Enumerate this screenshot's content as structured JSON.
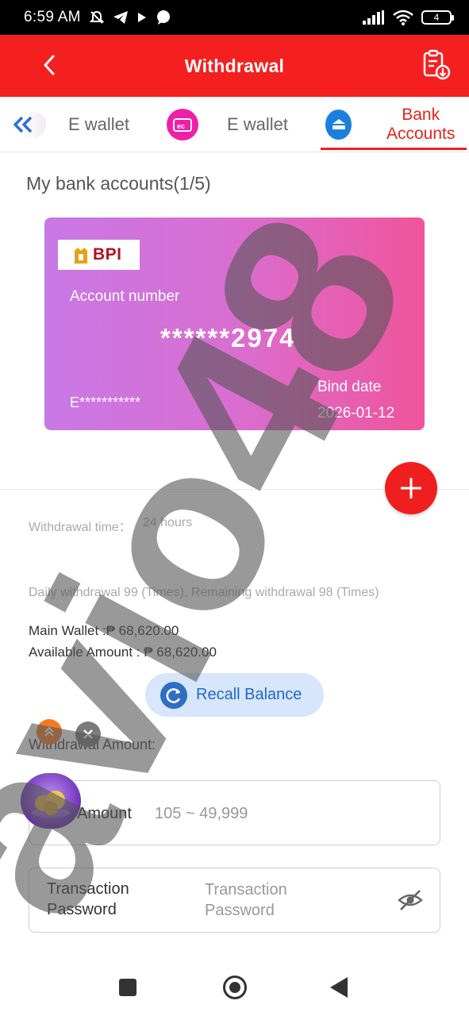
{
  "status_bar": {
    "time": "6:59 AM",
    "battery": "4",
    "icons": [
      "mute-icon",
      "telegram-icon",
      "play-icon",
      "chat-icon",
      "signal-icon",
      "wifi-icon",
      "battery-icon"
    ]
  },
  "header": {
    "title": "Withdrawal",
    "back_icon": "chevron-left-icon",
    "record_icon": "clipboard-download-icon",
    "background": "#f4201f"
  },
  "tabs": [
    {
      "label": "E wallet",
      "icon": ""
    },
    {
      "label": "E wallet",
      "icon": "ewallet-icon",
      "icon_color": "#f01fa8"
    },
    {
      "label": "Bank Accounts",
      "icon": "bank-card-icon",
      "icon_color": "#1b7fe0",
      "active": true
    }
  ],
  "bank_section": {
    "title": "My bank accounts(1/5)",
    "card": {
      "bank_name": "BPI",
      "account_label": "Account number",
      "account_number": "******2974",
      "holder_name": "E***********",
      "bind_date_label": "Bind date",
      "bind_date": "2026-01-12"
    },
    "add_icon": "plus-icon"
  },
  "info": {
    "withdrawal_time_label": "Withdrawal time：",
    "withdrawal_time_value": "24 hours",
    "daily_limit": "Daily withdrawal 99 (Times), Remaining withdrawal 98 (Times)",
    "main_wallet": "Main Wallet :₱ 68,620.00",
    "available_amount": "Available Amount : ₱ 68,620.00"
  },
  "recall": {
    "label": "Recall Balance",
    "icon": "refresh-icon"
  },
  "form": {
    "amount_heading": "Withdrawal Amount:",
    "amount_label": "Amount",
    "amount_placeholder": "105 ~ 49,999",
    "password_label_line1": "Transaction",
    "password_label_line2": "Password",
    "password_placeholder_line1": "Transaction",
    "password_placeholder_line2": "Password",
    "eye_icon": "eye-off-icon"
  },
  "watermark": {
    "text": "avio48"
  },
  "colors": {
    "accent_red": "#e8231e",
    "recall_blue": "#2468c8",
    "card_gradient_start": "#c878e6",
    "card_gradient_end": "#f0549b"
  }
}
